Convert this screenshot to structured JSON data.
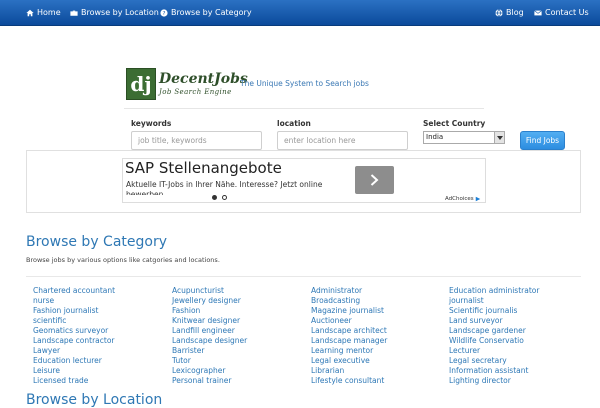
{
  "navbar": {
    "home": "Home",
    "browse_location": "Browse by Location",
    "browse_category": "Browse by Category",
    "blog": "Blog",
    "contact": "Contact Us",
    "background_color": "#0f4f9f"
  },
  "logo": {
    "mark": "dj",
    "name": "DecentJobs",
    "subtitle": "Job Search Engine",
    "tagline": "The Unique System to Search jobs"
  },
  "search": {
    "keywords_label": "keywords",
    "keywords_placeholder": "job title, keywords",
    "location_label": "location",
    "location_placeholder": "enter location here",
    "country_label": "Select Country",
    "country_value": "India",
    "button": "Find Jobs"
  },
  "ad": {
    "title": "SAP Stellenangebote",
    "description": "Aktuelle IT-Jobs in Ihrer Nähe. Interesse? Jetzt online bewerben.",
    "choices": "AdChoices"
  },
  "browse": {
    "title": "Browse by Category",
    "description": "Browse jobs by various options like catgories and locations.",
    "columns": [
      [
        "Chartered accountant",
        "nurse",
        "Fashion journalist",
        "scientific",
        "Geomatics surveyor",
        "Landscape contractor",
        "Lawyer",
        "Education lecturer",
        "Leisure",
        "Licensed trade"
      ],
      [
        "Acupuncturist",
        "Jewellery designer",
        "Fashion",
        "Knitwear designer",
        "Landfill engineer",
        "Landscape designer",
        "Barrister",
        "Tutor",
        "Lexicographer",
        "Personal trainer"
      ],
      [
        "Administrator",
        "Broadcasting",
        "Magazine journalist",
        "Auctioneer",
        "Landscape architect",
        "Landscape manager",
        "Learning mentor",
        "Legal executive",
        "Librarian",
        "Lifestyle consultant"
      ],
      [
        "Education administrator",
        "journalist",
        "Scientific journalis",
        "Land surveyor",
        "Landscape gardener",
        "Wildlife Conservatio",
        "Lecturer",
        "Legal secretary",
        "Information assistant",
        "Lighting director"
      ]
    ],
    "next_title": "Browse by Location"
  }
}
